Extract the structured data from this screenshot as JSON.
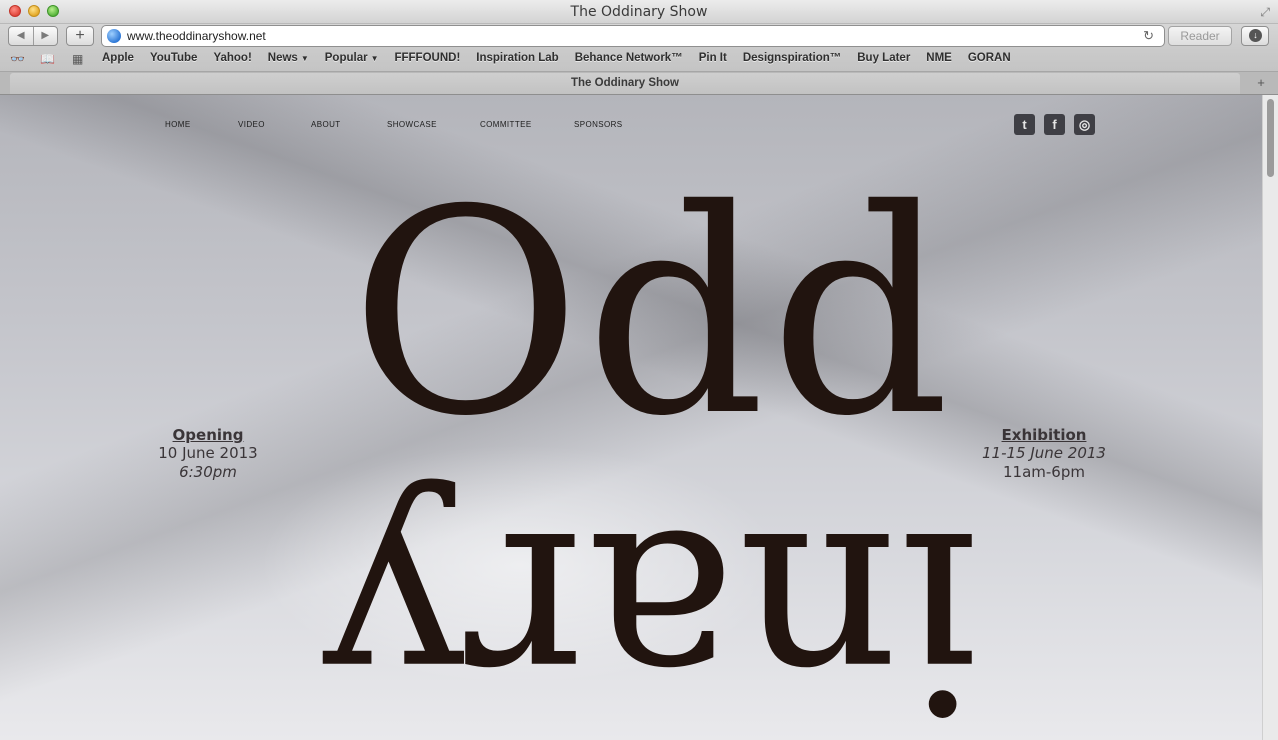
{
  "window": {
    "title": "The Oddinary Show"
  },
  "toolbar": {
    "back_icon": "◀",
    "forward_icon": "▶",
    "new_tab_label": "+",
    "url": "www.theoddinaryshow.net",
    "reader_label": "Reader"
  },
  "bookmarks": {
    "items": [
      {
        "label": "Apple",
        "menu": false
      },
      {
        "label": "YouTube",
        "menu": false
      },
      {
        "label": "Yahoo!",
        "menu": false
      },
      {
        "label": "News",
        "menu": true
      },
      {
        "label": "Popular",
        "menu": true
      },
      {
        "label": "FFFFOUND!",
        "menu": false
      },
      {
        "label": "Inspiration Lab",
        "menu": false
      },
      {
        "label": "Behance Network™",
        "menu": false
      },
      {
        "label": "Pin It",
        "menu": false
      },
      {
        "label": "Designspiration™",
        "menu": false
      },
      {
        "label": "Buy Later",
        "menu": false
      },
      {
        "label": "NME",
        "menu": false
      },
      {
        "label": "GORAN",
        "menu": false
      }
    ]
  },
  "tab": {
    "title": "The Oddinary Show"
  },
  "site": {
    "nav": [
      "HOME",
      "VIDEO",
      "ABOUT",
      "SHOWCASE",
      "COMMITTEE",
      "SPONSORS"
    ],
    "social": [
      {
        "name": "twitter",
        "glyph": "t"
      },
      {
        "name": "facebook",
        "glyph": "f"
      },
      {
        "name": "instagram",
        "glyph": "◎"
      }
    ],
    "logo_top": "Odd",
    "logo_bottom": "inary",
    "opening": {
      "heading": "Opening",
      "date": "10 June 2013",
      "time": "6:30pm"
    },
    "exhibition": {
      "heading": "Exhibition",
      "date": "11-15 June 2013",
      "time": "11am-6pm"
    }
  }
}
